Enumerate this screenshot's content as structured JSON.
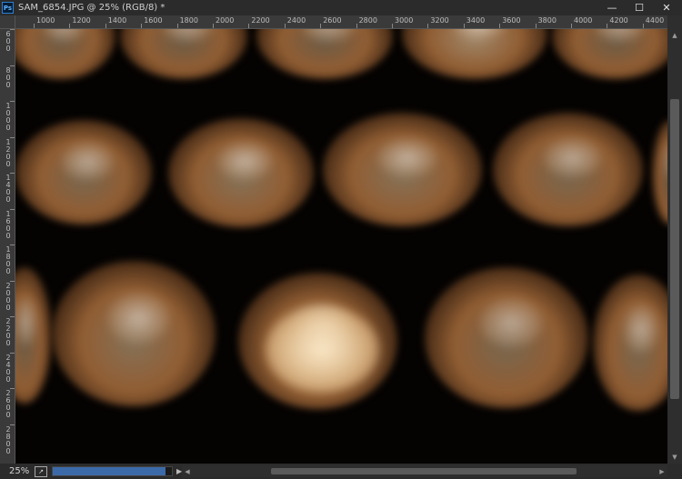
{
  "window": {
    "app_icon": "Ps",
    "title": "SAM_6854.JPG @ 25% (RGB/8) *",
    "controls": {
      "minimize": "—",
      "restore": "☐",
      "close": "✕"
    }
  },
  "ruler": {
    "top_ticks": [
      "1000",
      "1200",
      "1400",
      "1600",
      "1800",
      "2000",
      "2200",
      "2400",
      "2600",
      "2800",
      "3000",
      "3200",
      "3400",
      "3600",
      "3800",
      "4000",
      "4200",
      "4400"
    ],
    "left_ticks": [
      "600",
      "800",
      "1000",
      "1200",
      "1400",
      "1600",
      "1800",
      "2000",
      "2200",
      "2400",
      "2600",
      "2800"
    ]
  },
  "statusbar": {
    "zoom": "25%",
    "export_icon": "export-icon",
    "progress": 0.95,
    "arrow": "▶"
  },
  "scrollbars": {
    "up": "▲",
    "down": "▼",
    "left": "◀",
    "right": "▶"
  },
  "colors": {
    "canvas": "#050302",
    "cup_outer": "#6b4324",
    "cup_bright": "#f3dcb4",
    "accent_blue": "#3c6aa8"
  }
}
